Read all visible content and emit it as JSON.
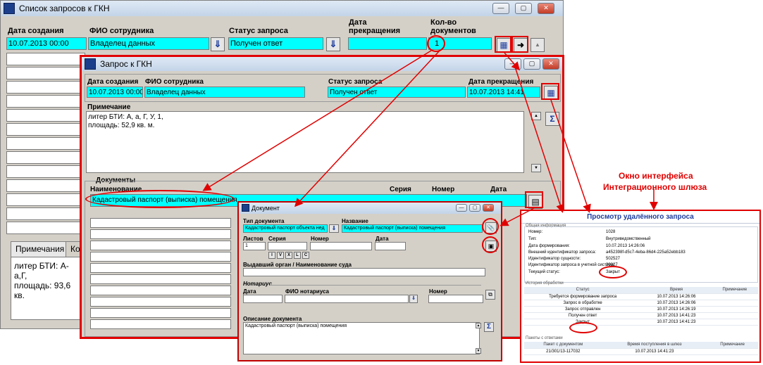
{
  "main_window": {
    "title": "Список запросов к ГКН",
    "col_created": "Дата создания",
    "col_employee": "ФИО сотрудника",
    "col_status": "Статус запроса",
    "col_end_line1": "Дата",
    "col_end_line2": "прекращения",
    "col_docs_line1": "Кол-во",
    "col_docs_line2": "документов",
    "created_value": "10.07.2013 00:00",
    "employee_value": "Владелец данных",
    "status_value": "Получен ответ",
    "docs_value": "1",
    "tabs": [
      "Примечания",
      "Ко"
    ],
    "note_lines": [
      "литер БТИ: А-а,Г,",
      "площадь: 93,6 кв."
    ]
  },
  "request_window": {
    "title": "Запрос к ГКН",
    "col_created": "Дата создания",
    "col_employee": "ФИО сотрудника",
    "col_status": "Статус запроса",
    "col_end": "Дата прекращения",
    "created_value": "10.07.2013 00:00",
    "employee_value": "Владелец данных",
    "status_value": "Получен ответ",
    "end_value": "10.07.2013 14:41",
    "note_label": "Примечание",
    "note_lines": [
      "литер БТИ: А, а, Г, У, 1,",
      "площадь: 52,9 кв. м."
    ],
    "documents_label": "Документы",
    "col_name": "Наименование",
    "col_series": "Серия",
    "col_number": "Номер",
    "col_date": "Дата",
    "doc_row_name": "Кадастровый паспорт (выписка) помещения"
  },
  "document_window": {
    "title": "Документ",
    "type_label": "Тип документа",
    "type_value": "Кадастровый паспорт объекта нед",
    "name_label": "Название",
    "name_value": "Кадастровый паспорт (выписка) помещения",
    "sheets_label": "Листов",
    "sheets_value": "1",
    "series_label": "Серия",
    "number_label": "Номер",
    "date_label": "Дата",
    "roman_buttons": [
      "I",
      "V",
      "X",
      "L",
      "C"
    ],
    "issuer_label": "Выдавший орган / Наименование суда",
    "notary_label": "Нотариус",
    "notary_date_label": "Дата",
    "notary_name_label": "ФИО нотариуса",
    "notary_number_label": "Номер",
    "desc_label": "Описание документа",
    "desc_value": "Кадастровый паспорт (выписка) помещения"
  },
  "annotation": {
    "line1": "Окно интерфейса",
    "line2": "Интеграционного шлюза"
  },
  "remote_view": {
    "title": "Просмотр удалённого запроса",
    "general_label": "Общая информация",
    "fields": [
      {
        "label": "Номер:",
        "value": "1028"
      },
      {
        "label": "Тип:",
        "value": "Внутриведомственный"
      },
      {
        "label": "Дата формирования:",
        "value": "10.07.2013 14:26:06"
      },
      {
        "label": "Внешний идентификатор запроса:",
        "value": "a452398f-d5c7-4eba-86d4-225a52ebb183"
      },
      {
        "label": "Идентификатор сущности:",
        "value": "502527"
      },
      {
        "label": "Идентификатор запроса в учетной системе:",
        "value": "20027"
      },
      {
        "label": "Текущий статус:",
        "value": "Закрыт"
      }
    ],
    "history_label": "История обработки",
    "history_cols": [
      "Статус",
      "Время",
      "Примечание"
    ],
    "history_rows": [
      [
        "Требуется формирование запроса",
        "10.07.2013 14:26:06",
        ""
      ],
      [
        "Запрос в обработке",
        "10.07.2013 14:26:06",
        ""
      ],
      [
        "Запрос отправлен",
        "10.07.2013 14:26:19",
        ""
      ],
      [
        "Получен ответ",
        "10.07.2013 14:41:23",
        ""
      ],
      [
        "Закрыт",
        "10.07.2013 14:41:23",
        ""
      ]
    ],
    "packages_label": "Пакеты с ответами",
    "packages_cols": [
      "Пакет с документом",
      "Время поступления в шлюз",
      "Примечание"
    ],
    "packages_rows": [
      [
        "21/301/13-117032",
        "10.07.2013 14:41:23",
        ""
      ]
    ]
  },
  "colors": {
    "highlight": "#00ffff",
    "annotation": "#e10000",
    "window_bg": "#d4d0c8"
  }
}
